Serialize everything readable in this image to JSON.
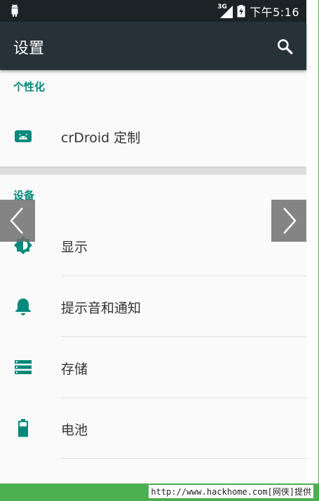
{
  "status_bar": {
    "network_label": "3G",
    "time": "下午5:16"
  },
  "action_bar": {
    "title": "设置"
  },
  "sections": [
    {
      "header": "个性化",
      "items": [
        {
          "label": "crDroid 定制",
          "icon": "android-icon"
        }
      ]
    },
    {
      "header": "设备",
      "items": [
        {
          "label": "显示",
          "icon": "brightness-icon"
        },
        {
          "label": "提示音和通知",
          "icon": "bell-icon"
        },
        {
          "label": "存储",
          "icon": "storage-icon"
        },
        {
          "label": "电池",
          "icon": "battery-icon"
        }
      ]
    }
  ],
  "colors": {
    "accent": "#00897b",
    "toolbar": "#263238",
    "status_bar": "#1b2327",
    "footer": "#4caf50"
  },
  "footer": {
    "text": "http://www.hackhome.com[网侠]提供"
  }
}
